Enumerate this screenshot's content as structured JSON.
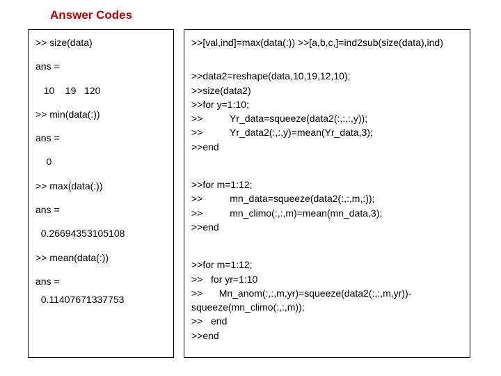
{
  "title": "Answer Codes",
  "left": {
    "l1": ">> size(data)",
    "l2": "ans =",
    "l3": "   10    19   120",
    "l4": ">> min(data(:))",
    "l5": "ans =",
    "l6": "    0",
    "l7": ">> max(data(:))",
    "l8": "ans =",
    "l9": "  0.26694353105108",
    "l10": ">> mean(data(:))",
    "l11": "ans =",
    "l12": "  0.11407671337753"
  },
  "right": {
    "r1": ">>[val,ind]=max(data(:)) >>[a,b,c,]=ind2sub(size(data),ind)",
    "r2": ">>data2=reshape(data,10,19,12,10);",
    "r3": ">>size(data2)",
    "r4": ">>for y=1:10;",
    "r5": ">>          Yr_data=squeeze(data2(:,:,:,y));",
    "r6": ">>          Yr_data2(:,:,y)=mean(Yr_data,3);",
    "r7": ">>end",
    "r8": ">>for m=1:12;",
    "r9": ">>          mn_data=squeeze(data2(:,:,m,:));",
    "r10": ">>          mn_climo(:,:,m)=mean(mn_data,3);",
    "r11": ">>end",
    "r12": ">>for m=1:12;",
    "r13": ">>   for yr=1:10",
    "r14": ">>      Mn_anom(:,:,m,yr)=squeeze(data2(:,:,m,yr))-",
    "r15": "squeeze(mn_climo(:,:,m));",
    "r16": ">>   end",
    "r17": ">>end"
  }
}
